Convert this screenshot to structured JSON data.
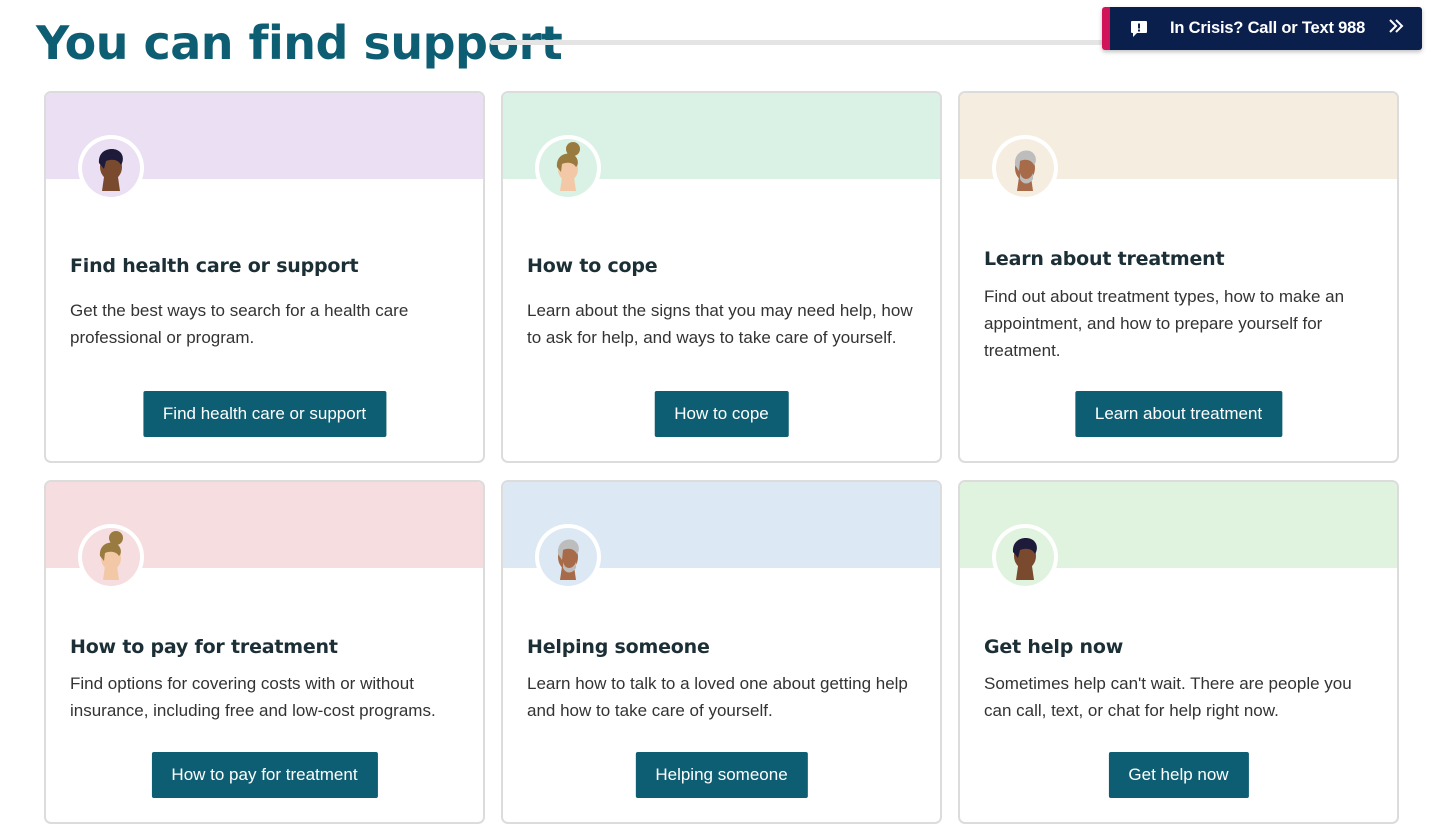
{
  "page": {
    "title": "You can find support"
  },
  "crisis_banner": {
    "text": "In Crisis? Call or Text 988",
    "icon": "message-alert-icon",
    "chevron_icon": "double-chevron-right-icon"
  },
  "colors": {
    "primary": "#0e5e73",
    "banner_bg": "#0b1f4d",
    "banner_accent": "#d1145a"
  },
  "cards": [
    {
      "heading": "Find health care or support",
      "description": "Get the best ways to search for a health care professional or program.",
      "button": "Find health care or support",
      "band_color": "#ebdff3",
      "avatar": "person-short-dark-hair-icon"
    },
    {
      "heading": "How to cope",
      "description": "Learn about the signs that you may need help, how to ask for help, and ways to take care of yourself.",
      "button": "How to cope",
      "band_color": "#d9f2e5",
      "avatar": "person-hair-bun-icon"
    },
    {
      "heading": "Learn about treatment",
      "description": "Find out about treatment types, how to make an appointment, and how to prepare yourself for treatment.",
      "button": "Learn about treatment",
      "band_color": "#f5ede0",
      "avatar": "person-gray-hair-beard-icon"
    },
    {
      "heading": "How to pay for treatment",
      "description": "Find options for covering costs with or without insurance, including free and low-cost programs.",
      "button": "How to pay for treatment",
      "band_color": "#f6dde0",
      "avatar": "person-hair-bun-icon"
    },
    {
      "heading": "Helping someone",
      "description": "Learn how to talk to a loved one about getting help and how to take care of yourself.",
      "button": "Helping someone",
      "band_color": "#dce9f4",
      "avatar": "person-gray-hair-beard-icon"
    },
    {
      "heading": "Get help now",
      "description": "Sometimes help can't wait. There are people you can call, text, or chat for help right now.",
      "button": "Get help now",
      "band_color": "#dff3de",
      "avatar": "person-short-dark-hair-icon"
    }
  ]
}
